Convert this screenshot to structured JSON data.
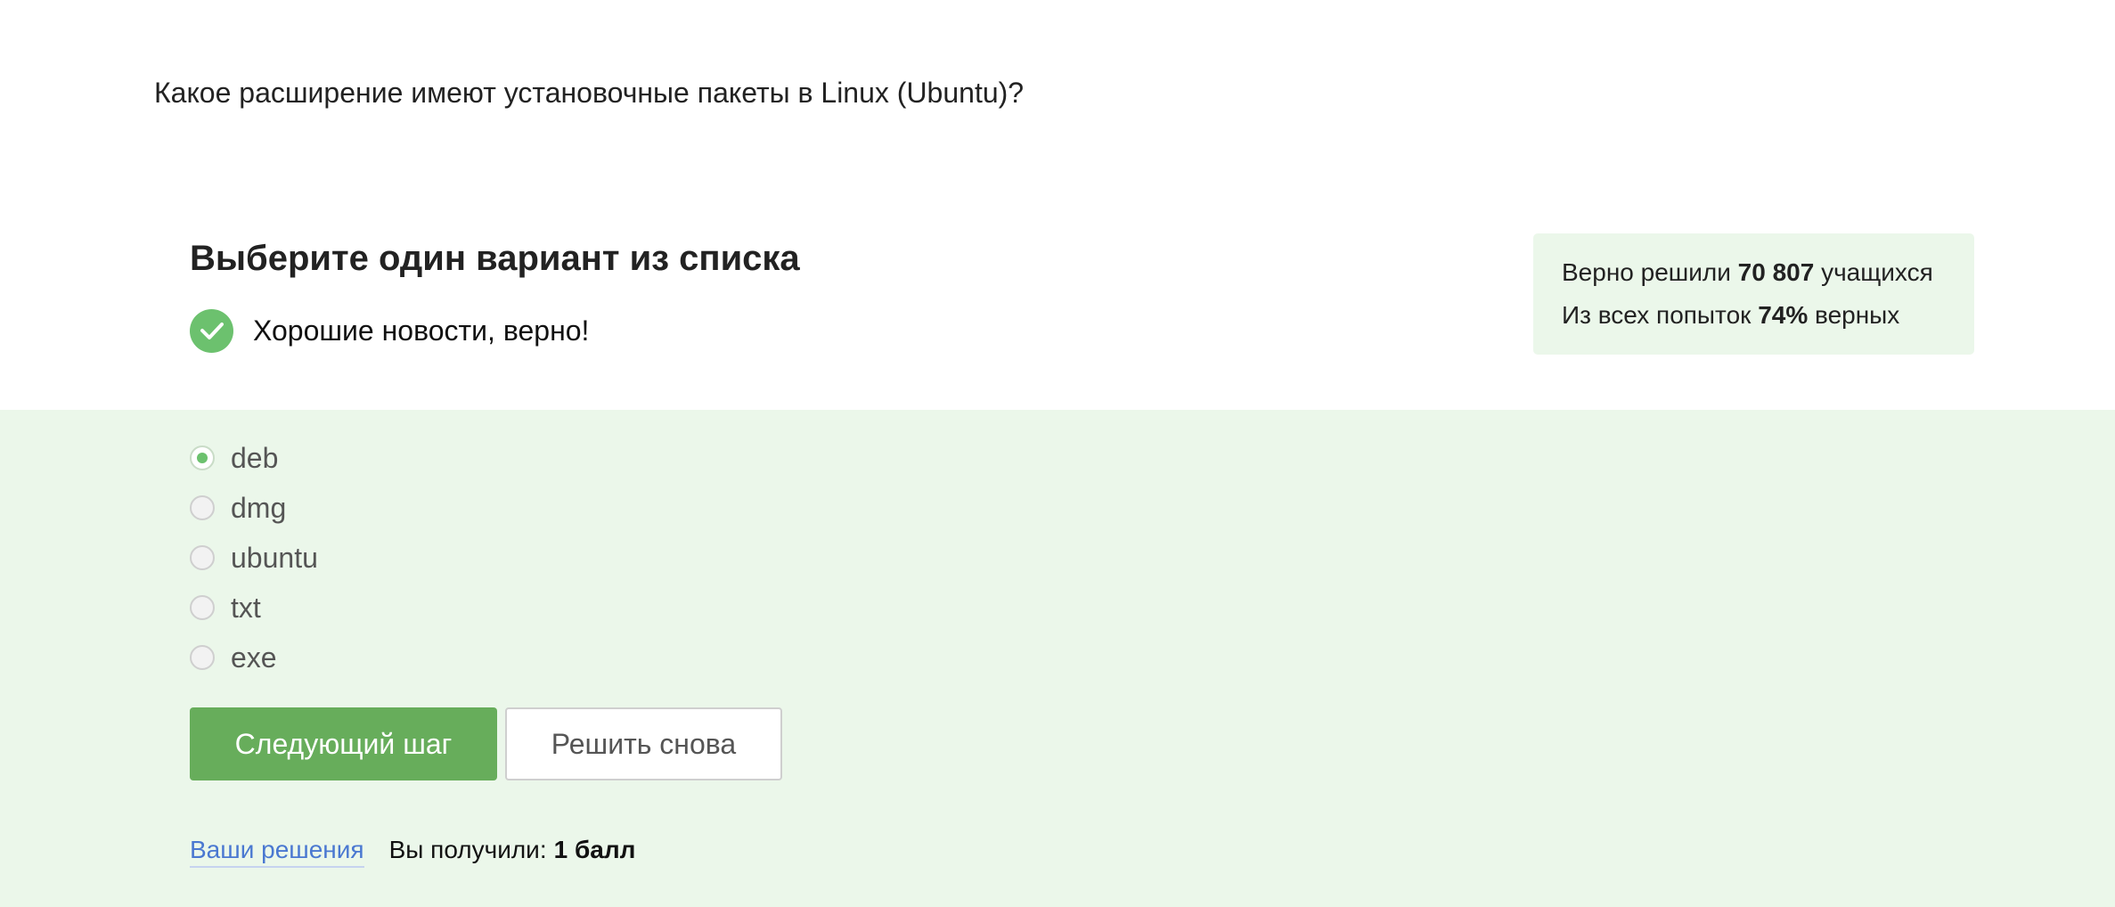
{
  "question": {
    "text": "Какое расширение имеют установочные пакеты в Linux (Ubuntu)?"
  },
  "quiz": {
    "heading": "Выберите один вариант из списка",
    "feedback": "Хорошие новости, верно!",
    "options": [
      {
        "label": "deb",
        "selected": true
      },
      {
        "label": "dmg",
        "selected": false
      },
      {
        "label": "ubuntu",
        "selected": false
      },
      {
        "label": "txt",
        "selected": false
      },
      {
        "label": "exe",
        "selected": false
      }
    ]
  },
  "stats": {
    "line1_prefix": "Верно решили",
    "line1_value": "70 807",
    "line1_suffix": "учащихся",
    "line2_prefix": "Из всех попыток",
    "line2_value": "74%",
    "line2_suffix": "верных"
  },
  "actions": {
    "next_label": "Следующий шаг",
    "retry_label": "Решить снова"
  },
  "footer": {
    "solutions_link": "Ваши решения",
    "score_prefix": "Вы получили:",
    "score_value": "1 балл"
  },
  "colors": {
    "accent_green": "#67ad5b",
    "check_green": "#6cc16e",
    "success_background": "#ebf7ea",
    "link_blue": "#4a78d1"
  },
  "icons": {
    "feedback_icon": "check-icon"
  }
}
